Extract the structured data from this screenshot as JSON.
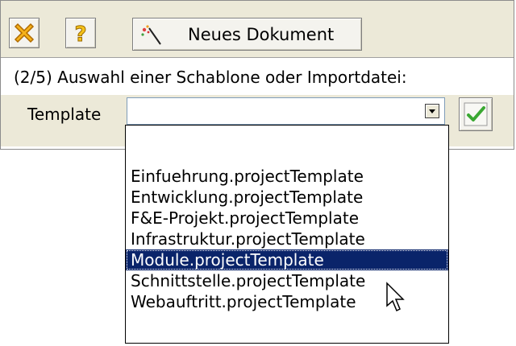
{
  "toolbar": {
    "close_icon": "close-x-icon",
    "help_icon": "question-mark-icon",
    "new_document_icon": "wand-icon",
    "new_document_label": "Neues Dokument"
  },
  "wizard": {
    "instruction": "(2/5) Auswahl einer Schablone oder Importdatei:",
    "field_label": "Template",
    "select_value": "",
    "confirm_icon": "checkmark-icon"
  },
  "dropdown": {
    "items": [
      "",
      "Einfuehrung.projectTemplate",
      "Entwicklung.projectTemplate",
      "F&E-Projekt.projectTemplate",
      "Infrastruktur.projectTemplate",
      "Module.projectTemplate",
      "Schnittstelle.projectTemplate",
      "Webauftritt.projectTemplate"
    ],
    "selected_index": 5
  },
  "colors": {
    "dialog_bg": "#ece9d8",
    "selection_bg": "#0a246a",
    "close_icon": "#f0a010",
    "confirm_icon": "#3aa832"
  }
}
